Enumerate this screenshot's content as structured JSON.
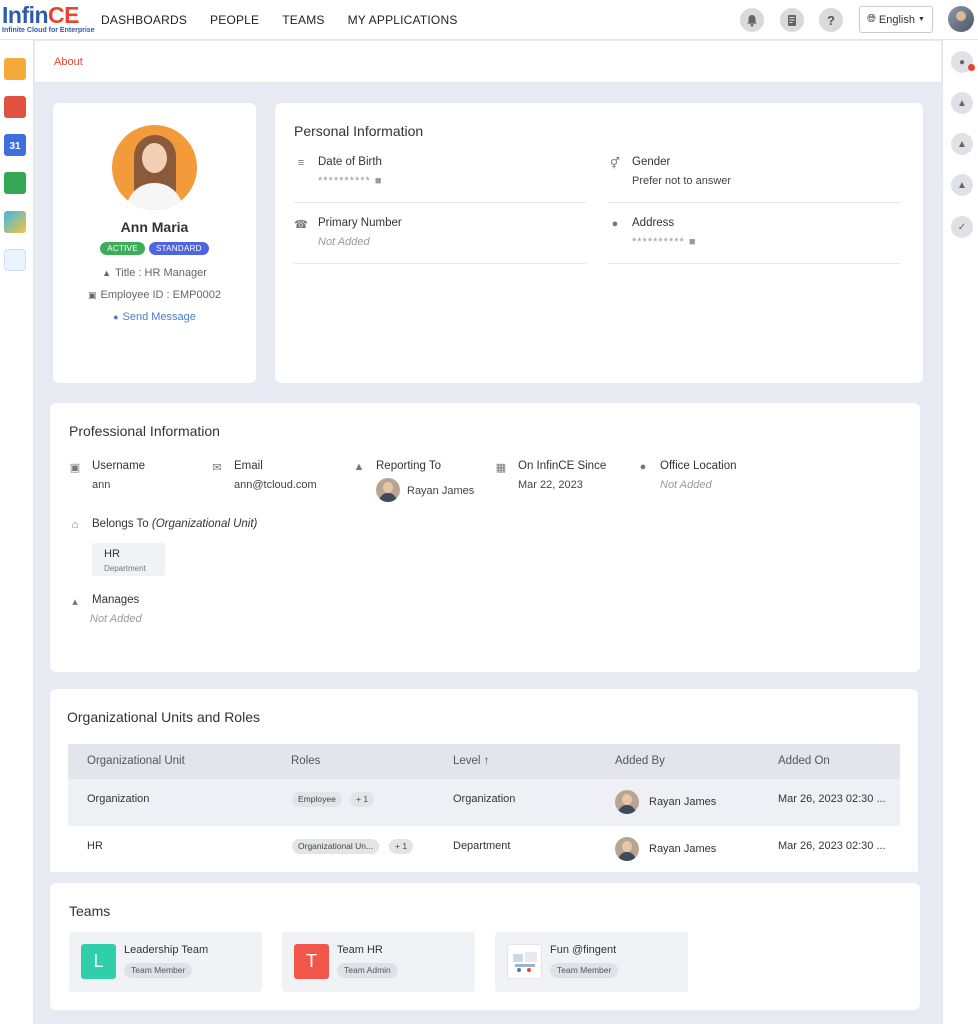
{
  "brand": {
    "logo_part1": "Infin",
    "logo_part2": "CE",
    "tagline": "Infinite Cloud for Enterprise"
  },
  "nav": [
    "DASHBOARDS",
    "PEOPLE",
    "TEAMS",
    "MY APPLICATIONS"
  ],
  "header": {
    "help_label": "?",
    "language": "English"
  },
  "breadcrumb": "About",
  "profile": {
    "name": "Ann Maria",
    "status_badge": "ACTIVE",
    "type_badge": "STANDARD",
    "title": "Title : HR Manager",
    "employee_id": "Employee ID : EMP0002",
    "send_message": "Send Message"
  },
  "personal": {
    "title": "Personal Information",
    "dob_label": "Date of Birth",
    "dob_value": "**********",
    "gender_label": "Gender",
    "gender_value": "Prefer not to answer",
    "phone_label": "Primary Number",
    "phone_value": "Not Added",
    "address_label": "Address",
    "address_value": "**********"
  },
  "professional": {
    "title": "Professional Information",
    "username_label": "Username",
    "username_value": "ann",
    "email_label": "Email",
    "email_value": "ann@tcloud.com",
    "reporting_label": "Reporting To",
    "reporting_value": "Rayan James",
    "since_label": "On InfinCE Since",
    "since_value": "Mar 22, 2023",
    "office_label": "Office Location",
    "office_value": "Not Added",
    "belongs_label": "Belongs To",
    "belongs_sub": "(Organizational Unit)",
    "ou_name": "HR",
    "ou_type": "Department",
    "manages_label": "Manages",
    "manages_value": "Not Added"
  },
  "org_units": {
    "title": "Organizational Units and Roles",
    "columns": [
      "Organizational Unit",
      "Roles",
      "Level ↑",
      "Added By",
      "Added On"
    ],
    "rows": [
      {
        "unit": "Organization",
        "role": "Employee",
        "more": "+ 1",
        "level": "Organization",
        "added_by": "Rayan James",
        "added_on": "Mar 26, 2023 02:30 ..."
      },
      {
        "unit": "HR",
        "role": "Organizational Un...",
        "more": "+ 1",
        "level": "Department",
        "added_by": "Rayan James",
        "added_on": "Mar 26, 2023 02:30 ..."
      }
    ]
  },
  "teams": {
    "title": "Teams",
    "items": [
      {
        "initial": "L",
        "name": "Leadership Team",
        "role": "Team Member",
        "color": "#2fcfa9"
      },
      {
        "initial": "T",
        "name": "Team HR",
        "role": "Team Admin",
        "color": "#f2564b"
      },
      {
        "initial": "",
        "name": "Fun @fingent",
        "role": "Team Member",
        "color": "#ffffff"
      }
    ]
  },
  "colors": {
    "accent": "#e8452f",
    "badge_active": "#3cae5a",
    "badge_standard": "#4f64e0",
    "link": "#4c7bc6"
  }
}
